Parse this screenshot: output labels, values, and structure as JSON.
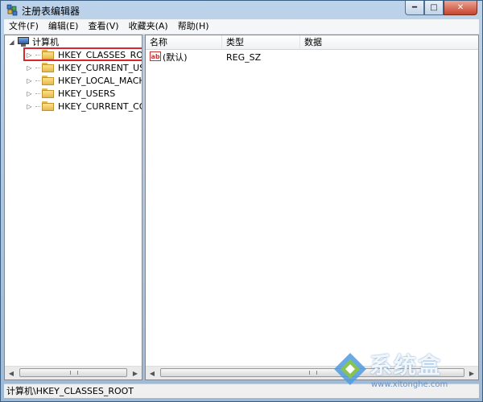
{
  "window": {
    "title": "注册表编辑器"
  },
  "caption": {
    "minimize": "━",
    "maximize": "□",
    "close": "✕"
  },
  "menu": [
    "文件(F)",
    "编辑(E)",
    "查看(V)",
    "收藏夹(A)",
    "帮助(H)"
  ],
  "tree": {
    "root": "计算机",
    "items": [
      "HKEY_CLASSES_ROOT",
      "HKEY_CURRENT_USER",
      "HKEY_LOCAL_MACHINE",
      "HKEY_USERS",
      "HKEY_CURRENT_CONFIG"
    ],
    "expander_collapsed": "▷",
    "expander_expanded": "◢"
  },
  "list": {
    "columns": [
      "名称",
      "类型",
      "数据"
    ],
    "rows": [
      {
        "icon_text": "ab",
        "name": "(默认)",
        "type": "REG_SZ",
        "data": ""
      }
    ]
  },
  "scroll": {
    "left": "◀",
    "right": "▶",
    "grip": "|||"
  },
  "status": "计算机\\HKEY_CLASSES_ROOT",
  "watermark": {
    "text": "系统盒",
    "url": "www.xitonghe.com"
  },
  "colors": {
    "highlight": "#d9262b",
    "folder": "#fde28a"
  }
}
